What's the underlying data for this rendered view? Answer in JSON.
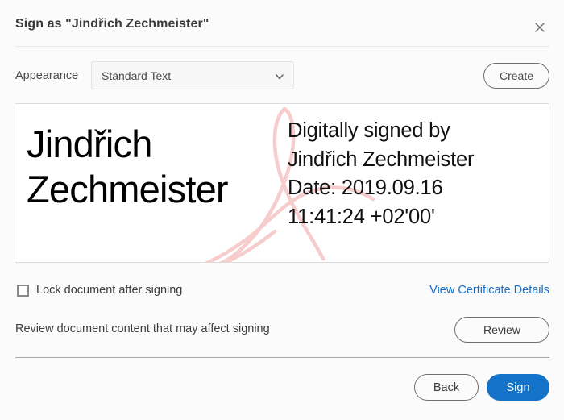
{
  "dialog": {
    "title": "Sign as \"Jindřich Zechmeister\"",
    "close_icon": "close-icon"
  },
  "appearance": {
    "label": "Appearance",
    "selected_option": "Standard Text",
    "options": [
      "Standard Text"
    ],
    "chevron_icon": "chevron-down-icon",
    "create_label": "Create"
  },
  "preview": {
    "signature_name": "Jindřich Zechmeister",
    "details": {
      "line1": "Digitally signed by",
      "line2": "Jindřich Zechmeister",
      "line3": "Date: 2019.09.16",
      "line4": "11:41:24 +02'00'"
    },
    "flourish_icon": "acrobat-swoosh-icon"
  },
  "lock": {
    "checkbox_label": "Lock document after signing",
    "checked": false,
    "certificate_link": "View Certificate Details"
  },
  "review": {
    "text": "Review document content that may affect signing",
    "button_label": "Review"
  },
  "footer": {
    "back_label": "Back",
    "sign_label": "Sign"
  },
  "colors": {
    "accent_blue": "#1473c8",
    "link_blue": "#1a6fc4",
    "flourish_pink": "#f6cccc",
    "dialog_background": "#fbfbfb",
    "border_gray": "#707070"
  }
}
